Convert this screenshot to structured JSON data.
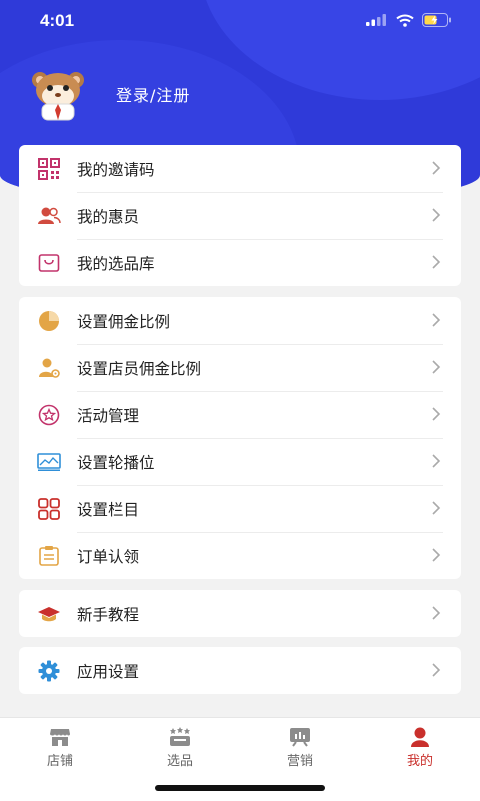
{
  "status": {
    "time": "4:01"
  },
  "profile": {
    "login_label": "登录/注册"
  },
  "sections": [
    {
      "items": [
        {
          "label": "我的邀请码",
          "icon": "qr-code-icon"
        },
        {
          "label": "我的惠员",
          "icon": "users-icon"
        },
        {
          "label": "我的选品库",
          "icon": "bag-icon"
        }
      ]
    },
    {
      "items": [
        {
          "label": "设置佣金比例",
          "icon": "pie-chart-icon"
        },
        {
          "label": "设置店员佣金比例",
          "icon": "user-gear-icon"
        },
        {
          "label": "活动管理",
          "icon": "star-badge-icon"
        },
        {
          "label": "设置轮播位",
          "icon": "image-banner-icon"
        },
        {
          "label": "设置栏目",
          "icon": "grid-icon"
        },
        {
          "label": "订单认领",
          "icon": "clipboard-icon"
        }
      ]
    },
    {
      "items": [
        {
          "label": "新手教程",
          "icon": "graduation-cap-icon"
        }
      ]
    },
    {
      "items": [
        {
          "label": "应用设置",
          "icon": "gear-icon"
        }
      ]
    }
  ],
  "tabs": [
    {
      "label": "店铺",
      "icon": "store-icon"
    },
    {
      "label": "选品",
      "icon": "products-icon"
    },
    {
      "label": "营销",
      "icon": "marketing-icon"
    },
    {
      "label": "我的",
      "icon": "profile-icon",
      "active": true
    }
  ],
  "colors": {
    "hero": "#2f3ad9",
    "active_tab": "#c9302c"
  }
}
